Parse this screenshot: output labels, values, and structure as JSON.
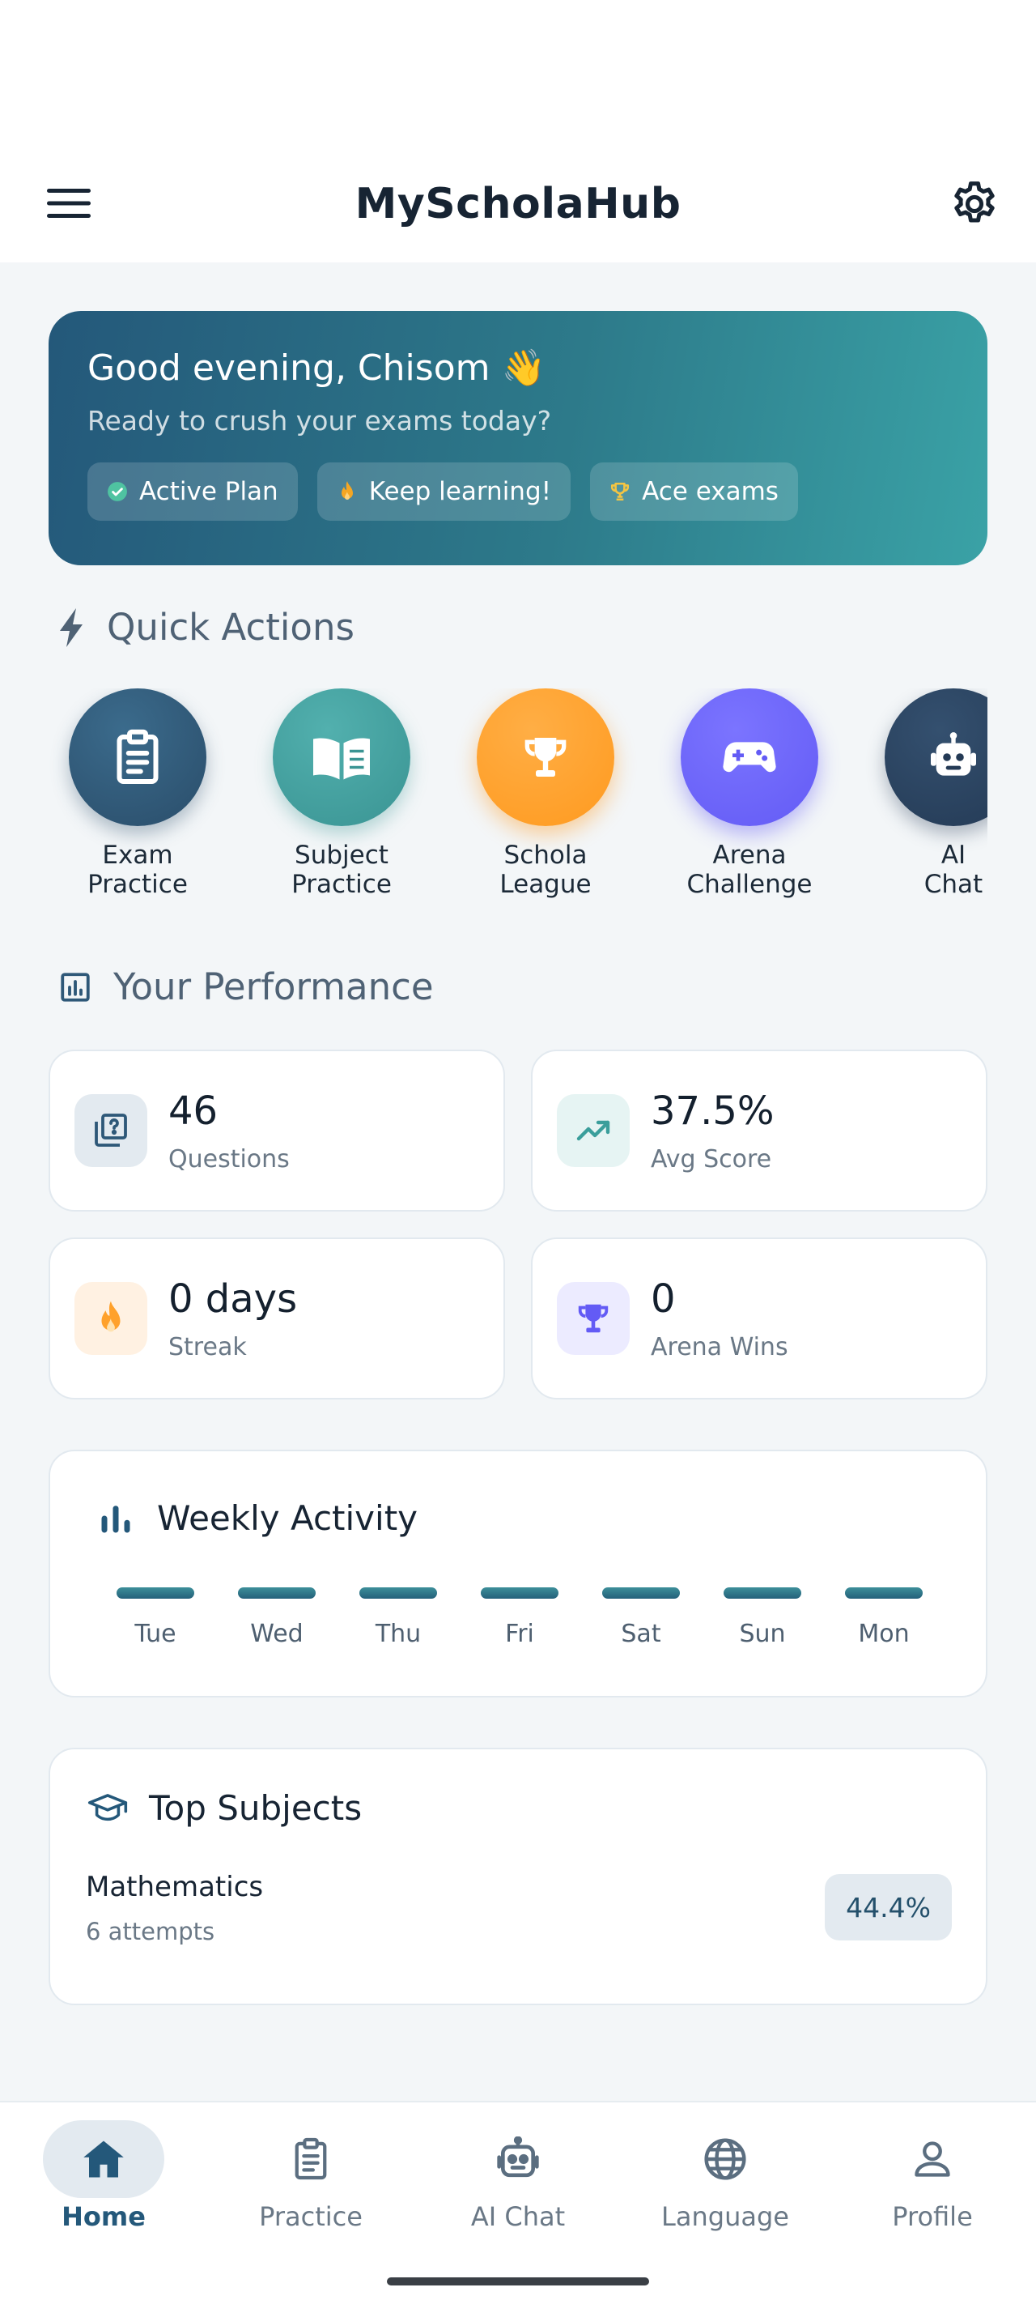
{
  "app": {
    "title": "MyScholaHub"
  },
  "header": {
    "menu_icon": "menu-icon",
    "settings_icon": "settings-gear-icon"
  },
  "hero": {
    "greeting": "Good evening, Chisom 👋",
    "subtitle": "Ready to crush your exams today?",
    "chips": [
      {
        "label": "Active Plan",
        "icon": "verified-check-icon",
        "color": "#4fc3a1"
      },
      {
        "label": "Keep learning!",
        "icon": "flame-icon",
        "color": "#f5a623"
      },
      {
        "label": "Ace exams",
        "icon": "trophy-icon",
        "color": "#f5c542"
      }
    ]
  },
  "quick_actions": {
    "title": "Quick Actions",
    "items": [
      {
        "label": "Exam\nPractice",
        "icon": "clipboard-icon",
        "color": "#2e5878"
      },
      {
        "label": "Subject\nPractice",
        "icon": "open-book-icon",
        "color": "#3f9e9e"
      },
      {
        "label": "Schola\nLeague",
        "icon": "trophy-icon",
        "color": "#ffa12b"
      },
      {
        "label": "Arena\nChallenge",
        "icon": "gamepad-icon",
        "color": "#6b63ff"
      },
      {
        "label": "AI\nChat",
        "icon": "robot-icon",
        "color": "#2a4060"
      }
    ]
  },
  "performance": {
    "title": "Your Performance",
    "stats": [
      {
        "value": "46",
        "label": "Questions",
        "icon": "quiz-question-icon"
      },
      {
        "value": "37.5%",
        "label": "Avg Score",
        "icon": "trending-up-icon"
      },
      {
        "value": "0 days",
        "label": "Streak",
        "icon": "flame-icon"
      },
      {
        "value": "0",
        "label": "Arena Wins",
        "icon": "trophy-icon"
      }
    ]
  },
  "weekly_activity": {
    "title": "Weekly Activity",
    "days": [
      "Tue",
      "Wed",
      "Thu",
      "Fri",
      "Sat",
      "Sun",
      "Mon"
    ]
  },
  "top_subjects": {
    "title": "Top Subjects",
    "items": [
      {
        "name": "Mathematics",
        "attempts": "6 attempts",
        "score": "44.4%"
      }
    ]
  },
  "bottom_nav": {
    "items": [
      {
        "label": "Home",
        "icon": "home-icon",
        "active": true
      },
      {
        "label": "Practice",
        "icon": "clipboard-icon",
        "active": false
      },
      {
        "label": "AI Chat",
        "icon": "robot-icon",
        "active": false
      },
      {
        "label": "Language",
        "icon": "globe-icon",
        "active": false
      },
      {
        "label": "Profile",
        "icon": "person-icon",
        "active": false
      }
    ]
  }
}
